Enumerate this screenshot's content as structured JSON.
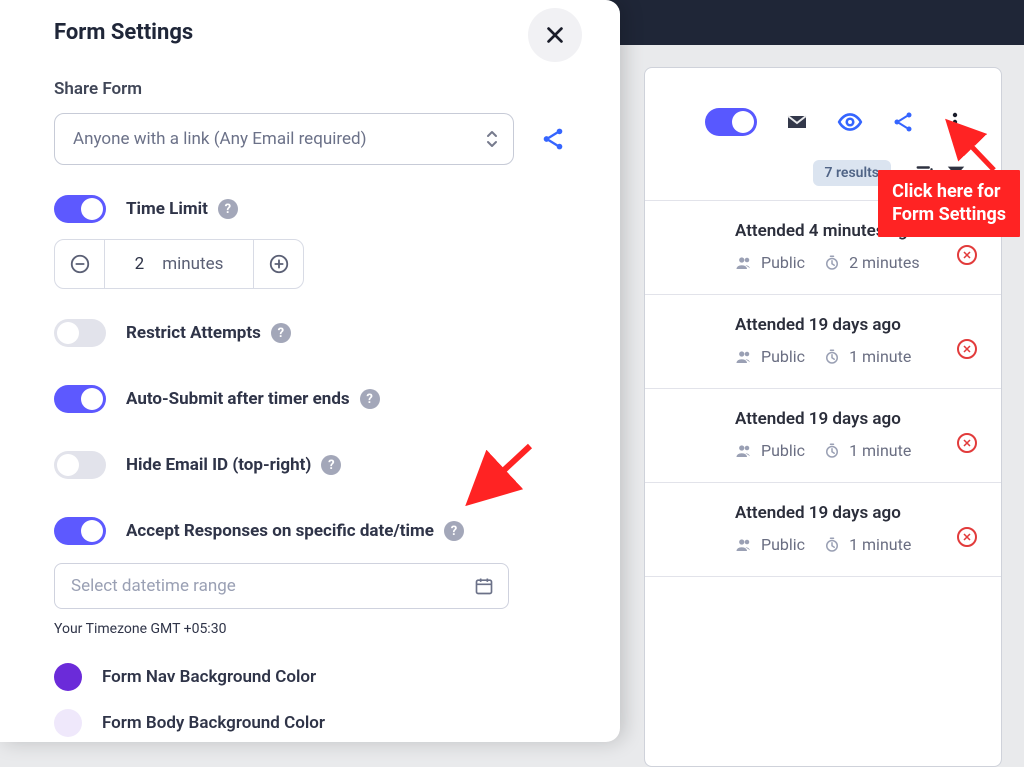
{
  "topbar_hint": "",
  "modal": {
    "title": "Form Settings",
    "share_label": "Share Form",
    "share_select": "Anyone with a link (Any Email required)",
    "time_limit_label": "Time Limit",
    "time_value": "2",
    "time_unit": "minutes",
    "restrict_label": "Restrict Attempts",
    "autosubmit_label": "Auto-Submit after timer ends",
    "hide_email_label": "Hide Email ID (top-right)",
    "accept_label": "Accept Responses on specific date/time",
    "datetime_placeholder": "Select datetime range",
    "tz_label": "Your Timezone GMT +05:30",
    "color_nav_label": "Form Nav Background Color",
    "color_body_label": "Form Body Background Color",
    "color_nav": "#6b2bd9",
    "color_body": "#efe8fb"
  },
  "card": {
    "results_chip": "7 results",
    "entries": [
      {
        "attended": "Attended 4 minutes ago",
        "visibility": "Public",
        "duration": "2 minutes"
      },
      {
        "attended": "Attended 19 days ago",
        "visibility": "Public",
        "duration": "1 minute"
      },
      {
        "attended": "Attended 19 days ago",
        "visibility": "Public",
        "duration": "1 minute"
      },
      {
        "attended": "Attended 19 days ago",
        "visibility": "Public",
        "duration": "1 minute"
      }
    ]
  },
  "annotation": {
    "hint": "Click here for\nForm Settings"
  }
}
